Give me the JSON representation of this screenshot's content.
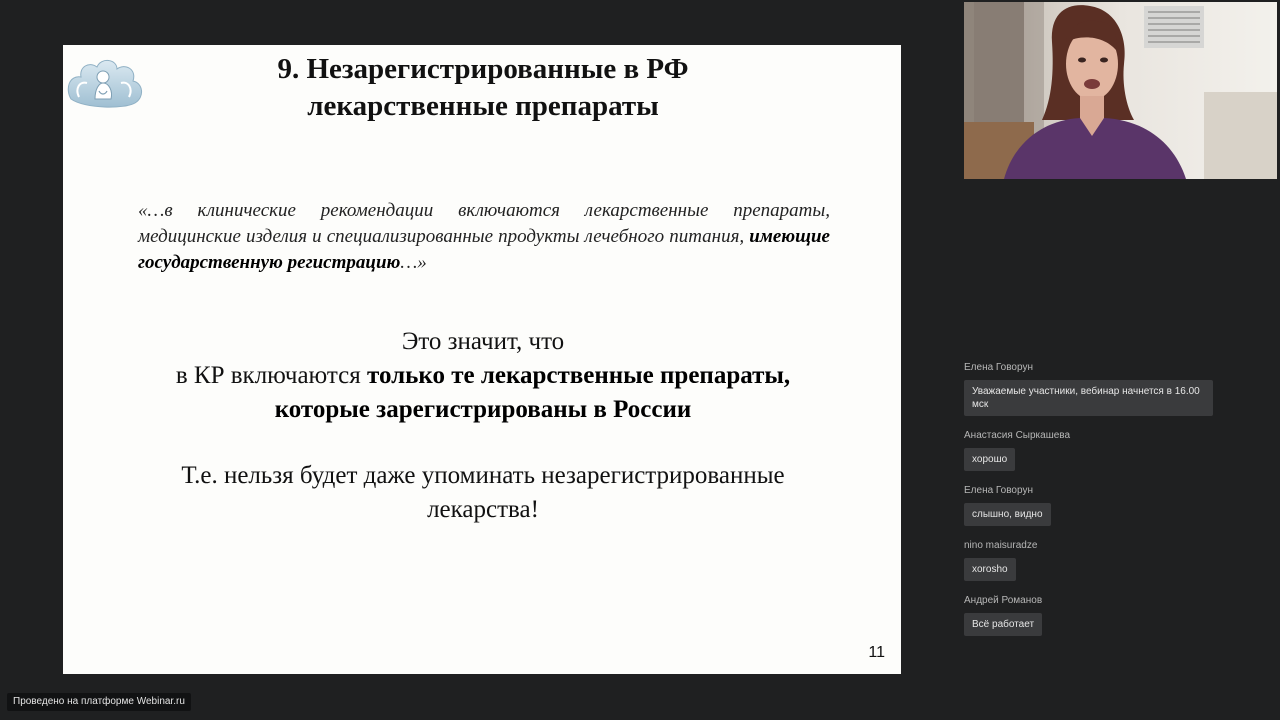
{
  "slide": {
    "title_line1": "9. Незарегистрированные в РФ",
    "title_line2": "лекарственные препараты",
    "quote_part1": "«…в клинические рекомендации включаются лекарственные препараты, медицинские изделия и специализированные продукты лечебного питания, ",
    "quote_bold": "имеющие государственную регистрацию",
    "quote_end": "…»",
    "meaning_line1": "Это значит, что",
    "meaning_line2_plain": "в КР включаются ",
    "meaning_line2_bold": "только те лекарственные препараты,",
    "meaning_line3_bold": "которые зарегистрированы в России",
    "note_line1": "Т.е. нельзя будет даже упоминать незарегистрированные",
    "note_line2": "лекарства!",
    "page_number": "11"
  },
  "chat": {
    "messages": [
      {
        "author": "Елена Говорун",
        "text": "Уважаемые участники, вебинар начнется в 16.00 мск"
      },
      {
        "author": "Анастасия Сыркашева",
        "text": "хорошо"
      },
      {
        "author": "Елена Говорун",
        "text": "слышно, видно"
      },
      {
        "author": "nino maisuradze",
        "text": "xorosho"
      },
      {
        "author": "Андрей Романов",
        "text": "Всё работает"
      }
    ]
  },
  "footer": {
    "platform_label": "Проведено на платформе Webinar.ru"
  },
  "colors": {
    "background": "#1f2021",
    "slide": "#fdfdfb",
    "bubble": "#3a3b3d"
  }
}
